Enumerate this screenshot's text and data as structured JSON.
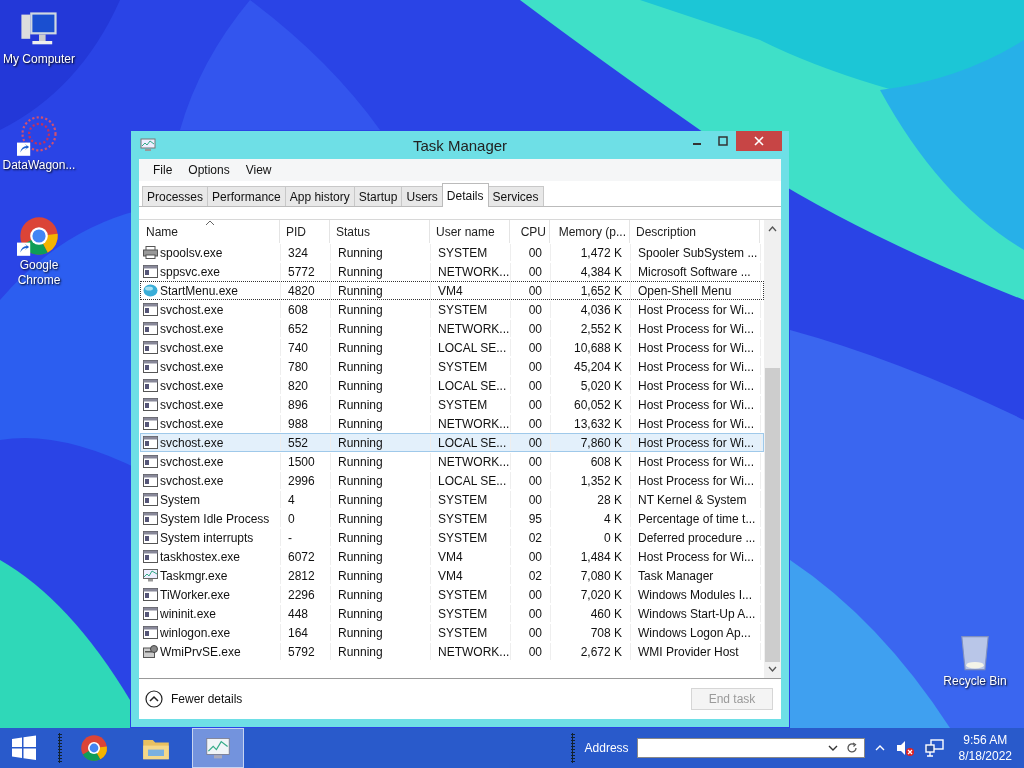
{
  "desktop_icons": [
    {
      "label": "My Computer",
      "kind": "computer",
      "shortcut": false
    },
    {
      "label": "DataWagon...",
      "kind": "dots",
      "shortcut": true
    },
    {
      "label": "Google Chrome",
      "kind": "chrome",
      "shortcut": true
    },
    {
      "label": "Recycle Bin",
      "kind": "bin",
      "shortcut": false
    }
  ],
  "window": {
    "title": "Task Manager"
  },
  "menu": [
    "File",
    "Options",
    "View"
  ],
  "tabs": [
    {
      "label": "Processes",
      "selected": false
    },
    {
      "label": "Performance",
      "selected": false
    },
    {
      "label": "App history",
      "selected": false
    },
    {
      "label": "Startup",
      "selected": false
    },
    {
      "label": "Users",
      "selected": false
    },
    {
      "label": "Details",
      "selected": true
    },
    {
      "label": "Services",
      "selected": false
    }
  ],
  "table": {
    "columns": [
      {
        "label": "Name",
        "sorted": true
      },
      {
        "label": "PID",
        "sorted": false
      },
      {
        "label": "Status",
        "sorted": false
      },
      {
        "label": "User name",
        "sorted": false
      },
      {
        "label": "CPU",
        "sorted": false
      },
      {
        "label": "Memory (p...",
        "sorted": false
      },
      {
        "label": "Description",
        "sorted": false
      }
    ],
    "rows": [
      {
        "kind": "printer",
        "cells": [
          "spoolsv.exe",
          "324",
          "Running",
          "SYSTEM",
          "00",
          "1,472 K",
          "Spooler SubSystem ..."
        ],
        "selected": false,
        "focused": false
      },
      {
        "kind": "app",
        "cells": [
          "sppsvc.exe",
          "5772",
          "Running",
          "NETWORK...",
          "00",
          "4,384 K",
          "Microsoft Software ..."
        ],
        "selected": false,
        "focused": false
      },
      {
        "kind": "shell",
        "cells": [
          "StartMenu.exe",
          "4820",
          "Running",
          "VM4",
          "00",
          "1,652 K",
          "Open-Shell Menu"
        ],
        "selected": false,
        "focused": true
      },
      {
        "kind": "app",
        "cells": [
          "svchost.exe",
          "608",
          "Running",
          "SYSTEM",
          "00",
          "4,036 K",
          "Host Process for Wi..."
        ],
        "selected": false,
        "focused": false
      },
      {
        "kind": "app",
        "cells": [
          "svchost.exe",
          "652",
          "Running",
          "NETWORK...",
          "00",
          "2,552 K",
          "Host Process for Wi..."
        ],
        "selected": false,
        "focused": false
      },
      {
        "kind": "app",
        "cells": [
          "svchost.exe",
          "740",
          "Running",
          "LOCAL SE...",
          "00",
          "10,688 K",
          "Host Process for Wi..."
        ],
        "selected": false,
        "focused": false
      },
      {
        "kind": "app",
        "cells": [
          "svchost.exe",
          "780",
          "Running",
          "SYSTEM",
          "00",
          "45,204 K",
          "Host Process for Wi..."
        ],
        "selected": false,
        "focused": false
      },
      {
        "kind": "app",
        "cells": [
          "svchost.exe",
          "820",
          "Running",
          "LOCAL SE...",
          "00",
          "5,020 K",
          "Host Process for Wi..."
        ],
        "selected": false,
        "focused": false
      },
      {
        "kind": "app",
        "cells": [
          "svchost.exe",
          "896",
          "Running",
          "SYSTEM",
          "00",
          "60,052 K",
          "Host Process for Wi..."
        ],
        "selected": false,
        "focused": false
      },
      {
        "kind": "app",
        "cells": [
          "svchost.exe",
          "988",
          "Running",
          "NETWORK...",
          "00",
          "13,632 K",
          "Host Process for Wi..."
        ],
        "selected": false,
        "focused": false
      },
      {
        "kind": "app",
        "cells": [
          "svchost.exe",
          "552",
          "Running",
          "LOCAL SE...",
          "00",
          "7,860 K",
          "Host Process for Wi..."
        ],
        "selected": true,
        "focused": false
      },
      {
        "kind": "app",
        "cells": [
          "svchost.exe",
          "1500",
          "Running",
          "NETWORK...",
          "00",
          "608 K",
          "Host Process for Wi..."
        ],
        "selected": false,
        "focused": false
      },
      {
        "kind": "app",
        "cells": [
          "svchost.exe",
          "2996",
          "Running",
          "LOCAL SE...",
          "00",
          "1,352 K",
          "Host Process for Wi..."
        ],
        "selected": false,
        "focused": false
      },
      {
        "kind": "app",
        "cells": [
          "System",
          "4",
          "Running",
          "SYSTEM",
          "00",
          "28 K",
          "NT Kernel & System"
        ],
        "selected": false,
        "focused": false
      },
      {
        "kind": "app",
        "cells": [
          "System Idle Process",
          "0",
          "Running",
          "SYSTEM",
          "95",
          "4 K",
          "Percentage of time t..."
        ],
        "selected": false,
        "focused": false
      },
      {
        "kind": "app",
        "cells": [
          "System interrupts",
          "-",
          "Running",
          "SYSTEM",
          "02",
          "0 K",
          "Deferred procedure ..."
        ],
        "selected": false,
        "focused": false
      },
      {
        "kind": "app",
        "cells": [
          "taskhostex.exe",
          "6072",
          "Running",
          "VM4",
          "00",
          "1,484 K",
          "Host Process for Wi..."
        ],
        "selected": false,
        "focused": false
      },
      {
        "kind": "chart",
        "cells": [
          "Taskmgr.exe",
          "2812",
          "Running",
          "VM4",
          "02",
          "7,080 K",
          "Task Manager"
        ],
        "selected": false,
        "focused": false
      },
      {
        "kind": "app",
        "cells": [
          "TiWorker.exe",
          "2296",
          "Running",
          "SYSTEM",
          "00",
          "7,020 K",
          "Windows Modules I..."
        ],
        "selected": false,
        "focused": false
      },
      {
        "kind": "app",
        "cells": [
          "wininit.exe",
          "448",
          "Running",
          "SYSTEM",
          "00",
          "460 K",
          "Windows Start-Up A..."
        ],
        "selected": false,
        "focused": false
      },
      {
        "kind": "app",
        "cells": [
          "winlogon.exe",
          "164",
          "Running",
          "SYSTEM",
          "00",
          "708 K",
          "Windows Logon Ap..."
        ],
        "selected": false,
        "focused": false
      },
      {
        "kind": "service",
        "cells": [
          "WmiPrvSE.exe",
          "5792",
          "Running",
          "NETWORK...",
          "00",
          "2,672 K",
          "WMI Provider Host"
        ],
        "selected": false,
        "focused": false
      }
    ]
  },
  "footer": {
    "fewer_details": "Fewer details",
    "end_task": {
      "label": "End task",
      "disabled": true
    }
  },
  "taskbar": {
    "apps": [
      {
        "kind": "chrome",
        "selected": false
      },
      {
        "kind": "folder",
        "selected": false
      },
      {
        "kind": "taskmgr",
        "selected": true
      }
    ],
    "address_label": "Address",
    "time": "9:56 AM",
    "date": "8/18/2022"
  }
}
